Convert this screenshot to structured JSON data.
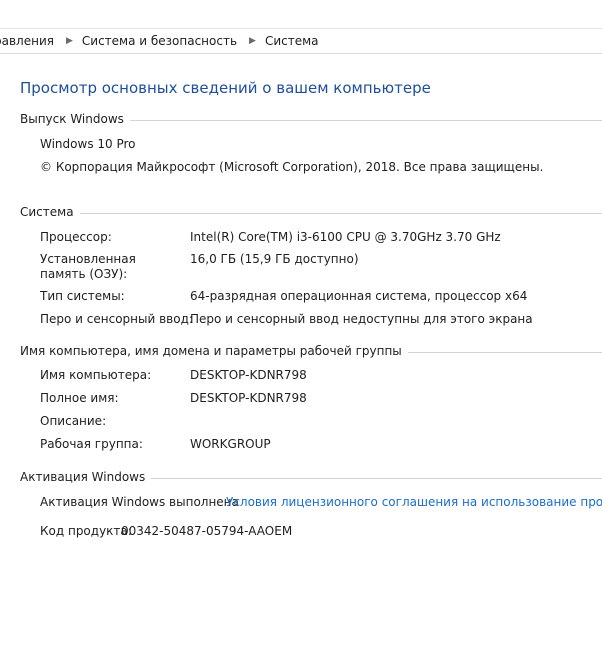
{
  "breadcrumb": {
    "items": [
      "равления",
      "Система и безопасность",
      "Система"
    ]
  },
  "main": {
    "title": "Просмотр основных сведений о вашем компьютере"
  },
  "windows_edition": {
    "header": "Выпуск Windows",
    "edition": "Windows 10 Pro",
    "copyright": "© Корпорация Майкрософт (Microsoft Corporation), 2018. Все права защищены."
  },
  "system": {
    "header": "Система",
    "rows": [
      {
        "label": "Процессор:",
        "value": "Intel(R) Core(TM) i3-6100 CPU @ 3.70GHz   3.70 GHz"
      },
      {
        "label": "Установленная память (ОЗУ):",
        "value": "16,0 ГБ (15,9 ГБ доступно)"
      },
      {
        "label": "Тип системы:",
        "value": "64-разрядная операционная система, процессор x64"
      },
      {
        "label": "Перо и сенсорный ввод:",
        "value": "Перо и сенсорный ввод недоступны для этого экрана"
      }
    ]
  },
  "computer_name": {
    "header": "Имя компьютера, имя домена и параметры рабочей группы",
    "rows": [
      {
        "label": "Имя компьютера:",
        "value": "DESKTOP-KDNR798"
      },
      {
        "label": "Полное имя:",
        "value": "DESKTOP-KDNR798"
      },
      {
        "label": "Описание:",
        "value": ""
      },
      {
        "label": "Рабочая группа:",
        "value": "WORKGROUP"
      }
    ]
  },
  "activation": {
    "header": "Активация Windows",
    "status": "Активация Windows выполнена",
    "license_link": "Условия лицензионного соглашения на использование программного обеспечения корпорации Майкрософт",
    "product_id_label": "Код продукта:",
    "product_id": "00342-50487-05794-AAOEM"
  },
  "colors": {
    "title": "#1f4e9c",
    "link": "#1a6ec7",
    "divider": "#d4d4d4"
  }
}
